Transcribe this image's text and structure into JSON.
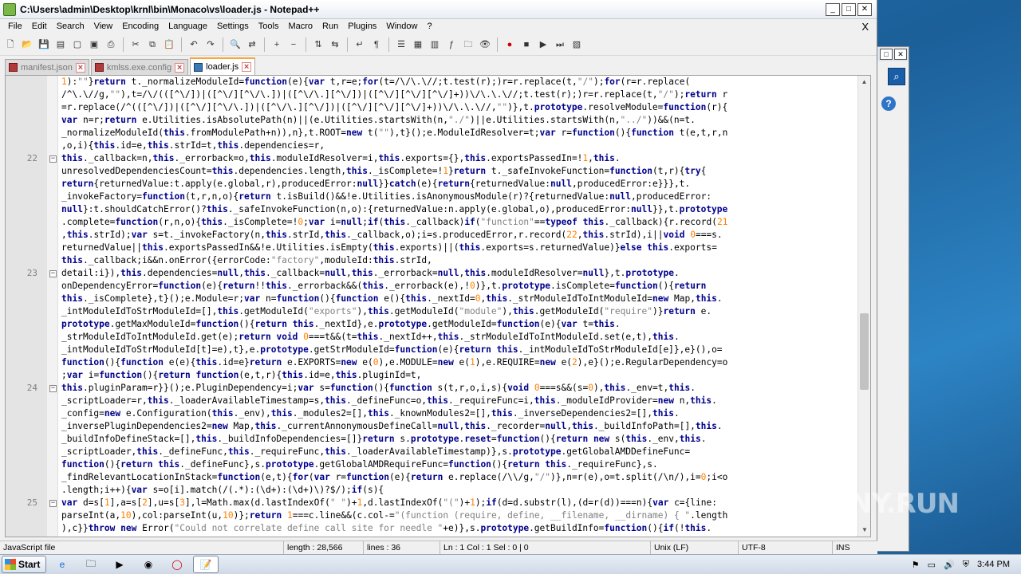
{
  "window": {
    "title": "C:\\Users\\admin\\Desktop\\krnl\\bin\\Monaco\\vs\\loader.js - Notepad++"
  },
  "menu": [
    "File",
    "Edit",
    "Search",
    "View",
    "Encoding",
    "Language",
    "Settings",
    "Tools",
    "Macro",
    "Run",
    "Plugins",
    "Window",
    "?"
  ],
  "menu_close": "X",
  "tabs": [
    {
      "label": "manifest.json",
      "active": false
    },
    {
      "label": "kmlss.exe.config",
      "active": false
    },
    {
      "label": "loader.js",
      "active": true
    }
  ],
  "line_numbers": {
    "l22": "22",
    "l23": "23",
    "l24": "24",
    "l25": "25"
  },
  "fold_marker": "−",
  "status": {
    "filetype": "JavaScript file",
    "length": "length : 28,566",
    "lines": "lines : 36",
    "position": "Ln : 1    Col : 1    Sel : 0 | 0",
    "eol": "Unix (LF)",
    "encoding": "UTF-8",
    "mode": "INS"
  },
  "taskbar": {
    "start": "Start",
    "time": "3:44 PM"
  },
  "watermark": "ANY.RUN",
  "code_lines": [
    "1):\"\"}return t._normalizeModuleId=function(e){var t,r=e;for(t=/\\/\\.\\//;t.test(r);)r=r.replace(t,\"/\");for(r=r.replace(",
    "/^\\.\\//g,\"\"),t=/\\/(([^\\/])|([^\\/][^\\/\\.])|([^\\/\\.][^\\/])|([^\\/][^\\/][^\\/]+))\\/\\.\\.\\//;t.test(r);)r=r.replace(t,\"/\");return r",
    "=r.replace(/^(([^\\/])|([^\\/][^\\/\\.])|([^\\/\\.][^\\/])|([^\\/][^\\/][^\\/]+))\\/\\.\\.\\//,\"\")},t.prototype.resolveModule=function(r){",
    "var n=r;return e.Utilities.isAbsolutePath(n)||(e.Utilities.startsWith(n,\"./\")||e.Utilities.startsWith(n,\"../\"))&&(n=t.",
    "_normalizeModuleId(this.fromModulePath+n)),n},t.ROOT=new t(\"\"),t}();e.ModuleIdResolver=t;var r=function(){function t(e,t,r,n",
    ",o,i){this.id=e,this.strId=t,this.dependencies=r,",
    "this._callback=n,this._errorback=o,this.moduleIdResolver=i,this.exports={},this.exportsPassedIn=!1,this.",
    "unresolvedDependenciesCount=this.dependencies.length,this._isComplete=!1}return t._safeInvokeFunction=function(t,r){try{",
    "return{returnedValue:t.apply(e.global,r),producedError:null}}catch(e){return{returnedValue:null,producedError:e}}},t.",
    "_invokeFactory=function(t,r,n,o){return t.isBuild()&&!e.Utilities.isAnonymousModule(r)?{returnedValue:null,producedError:",
    "null}:t.shouldCatchError()?this._safeInvokeFunction(n,o):{returnedValue:n.apply(e.global,o),producedError:null}},t.prototype",
    ".complete=function(r,n,o){this._isComplete=!0;var i=null;if(this._callback)if(\"function\"==typeof this._callback){r.record(21",
    ",this.strId);var s=t._invokeFactory(n,this.strId,this._callback,o);i=s.producedError,r.record(22,this.strId),i||void 0===s.",
    "returnedValue||this.exportsPassedIn&&!e.Utilities.isEmpty(this.exports)||(this.exports=s.returnedValue)}else this.exports=",
    "this._callback;i&&n.onError({errorCode:\"factory\",moduleId:this.strId,",
    "detail:i}),this.dependencies=null,this._callback=null,this._errorback=null,this.moduleIdResolver=null},t.prototype.",
    "onDependencyError=function(e){return!!this._errorback&&(this._errorback(e),!0)},t.prototype.isComplete=function(){return",
    "this._isComplete},t}();e.Module=r;var n=function(){function e(){this._nextId=0,this._strModuleIdToIntModuleId=new Map,this.",
    "_intModuleIdToStrModuleId=[],this.getModuleId(\"exports\"),this.getModuleId(\"module\"),this.getModuleId(\"require\")}return e.",
    "prototype.getMaxModuleId=function(){return this._nextId},e.prototype.getModuleId=function(e){var t=this.",
    "_strModuleIdToIntModuleId.get(e);return void 0===t&&(t=this._nextId++,this._strModuleIdToIntModuleId.set(e,t),this.",
    "_intModuleIdToStrModuleId[t]=e),t},e.prototype.getStrModuleId=function(e){return this._intModuleIdToStrModuleId[e]},e}(),o=",
    "function(){function e(e){this.id=e}return e.EXPORTS=new e(0),e.MODULE=new e(1),e.REQUIRE=new e(2),e}();e.RegularDependency=o",
    ";var i=function(){return function(e,t,r){this.id=e,this.pluginId=t,",
    "this.pluginParam=r}}();e.PluginDependency=i;var s=function(){function s(t,r,o,i,s){void 0===s&&(s=0),this._env=t,this.",
    "_scriptLoader=r,this._loaderAvailableTimestamp=s,this._defineFunc=o,this._requireFunc=i,this._moduleIdProvider=new n,this.",
    "_config=new e.Configuration(this._env),this._modules2=[],this._knownModules2=[],this._inverseDependencies2=[],this.",
    "_inversePluginDependencies2=new Map,this._currentAnnonymousDefineCall=null,this._recorder=null,this._buildInfoPath=[],this.",
    "_buildInfoDefineStack=[],this._buildInfoDependencies=[]}return s.prototype.reset=function(){return new s(this._env,this.",
    "_scriptLoader,this._defineFunc,this._requireFunc,this._loaderAvailableTimestamp)},s.prototype.getGlobalAMDDefineFunc=",
    "function(){return this._defineFunc},s.prototype.getGlobalAMDRequireFunc=function(){return this._requireFunc},s.",
    "_findRelevantLocationInStack=function(e,t){for(var r=function(e){return e.replace(/\\\\/g,\"/\")},n=r(e),o=t.split(/\\n/),i=0;i<o",
    ".length;i++){var s=o[i].match(/(.*):(\\d+):(\\d+)\\)?$/);if(s){",
    "var d=s[1],a=s[2],u=s[3],l=Math.max(d.lastIndexOf(\" \")+1,d.lastIndexOf(\"(\")+1);if(d=d.substr(l),(d=r(d))===n){var c={line:",
    "parseInt(a,10),col:parseInt(u,10)};return 1===c.line&&(c.col-=\"(function (require, define, __filename, __dirname) { \".length",
    "),c}}throw new Error(\"Could not correlate define call site for needle \"+e)},s.prototype.getBuildInfo=function(){if(!this."
  ]
}
